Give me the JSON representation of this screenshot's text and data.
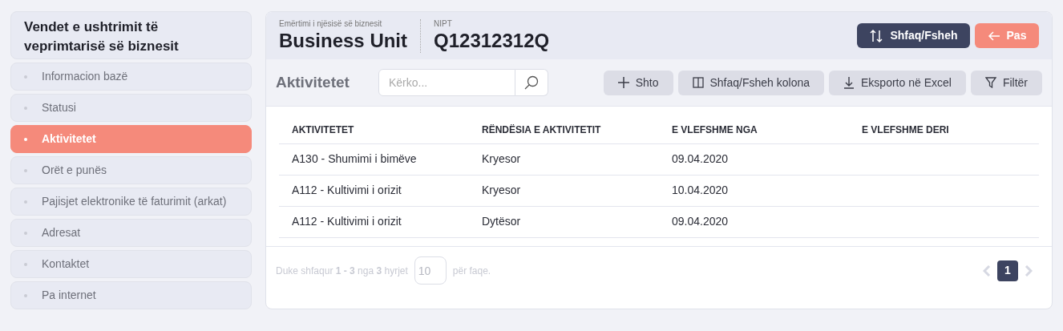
{
  "sidebar": {
    "title": "Vendet e ushtrimit të veprimtarisë së biznesit",
    "items": [
      {
        "label": "Informacion bazë",
        "selected": false
      },
      {
        "label": "Statusi",
        "selected": false
      },
      {
        "label": "Aktivitetet",
        "selected": true
      },
      {
        "label": "Orët e punës",
        "selected": false
      },
      {
        "label": "Pajisjet elektronike të faturimit (arkat)",
        "selected": false
      },
      {
        "label": "Adresat",
        "selected": false
      },
      {
        "label": "Kontaktet",
        "selected": false
      },
      {
        "label": "Pa internet",
        "selected": false
      }
    ]
  },
  "header": {
    "name_label": "Emërtimi i njësisë së biznesit",
    "name": "Business Unit",
    "nipt_label": "NIPT",
    "nipt": "Q12312312Q",
    "buttons": [
      {
        "label": "Shfaq/Fsheh",
        "kind": "toggle"
      },
      {
        "label": "Pas",
        "kind": "back"
      }
    ]
  },
  "toolbar": {
    "title": "Aktivitetet",
    "search": {
      "placeholder": "Kërko..."
    },
    "buttons": [
      "Shto",
      "Shfaq/Fsheh kolona",
      "Eksporto në Excel",
      "Filtër"
    ]
  },
  "table": {
    "columns": [
      "AKTIVITETET",
      "RËNDËSIA E AKTIVITETIT",
      "E VLEFSHME NGA",
      "E VLEFSHME DERI"
    ],
    "rows": [
      [
        "A130 - Shumimi i bimëve",
        "Kryesor",
        "09.04.2020"
      ],
      [
        "A112 - Kultivimi i orizit",
        "Kryesor",
        "10.04.2020"
      ],
      [
        "A112 - Kultivimi i orizit",
        "Dytësor",
        "09.04.2020"
      ]
    ]
  },
  "footer": {
    "info": "Duke shfaqur **1 - 3** nga **3** hyrjet",
    "page_size": "10",
    "per_page": "për faqe.",
    "pages": [
      {
        "label": "1",
        "selected": true
      }
    ]
  }
}
